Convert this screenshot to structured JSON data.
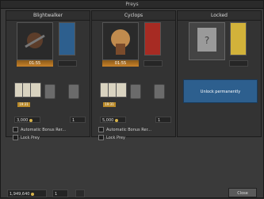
{
  "window": {
    "title": "Preys"
  },
  "panels": [
    {
      "title": "Blightwalker",
      "timer": "01:55",
      "price": "3,000",
      "free_count": "1",
      "tag": "19:31",
      "auto_label": "Automatic Bonus Rer...",
      "lock_label": "Lock Prey"
    },
    {
      "title": "Cyclops",
      "timer": "01:55",
      "price": "5,000",
      "free_count": "1",
      "tag": "19:31",
      "auto_label": "Automatic Bonus Rer...",
      "lock_label": "Lock Prey"
    },
    {
      "title": "Locked",
      "unlock_label": "Unlock permanently"
    }
  ],
  "footer": {
    "gold": "1,949,640",
    "small_count": "1",
    "close_label": "Close"
  },
  "colors": {
    "accent_blue": "#2d5f8e",
    "gold": "#c9822a"
  },
  "icons": [
    "blightwalker-icon",
    "cyclops-icon",
    "banner-blue-icon",
    "banner-red-icon",
    "lock-question-icon",
    "banner-yellow-icon",
    "gold-coin-icon",
    "wrench-icon"
  ]
}
